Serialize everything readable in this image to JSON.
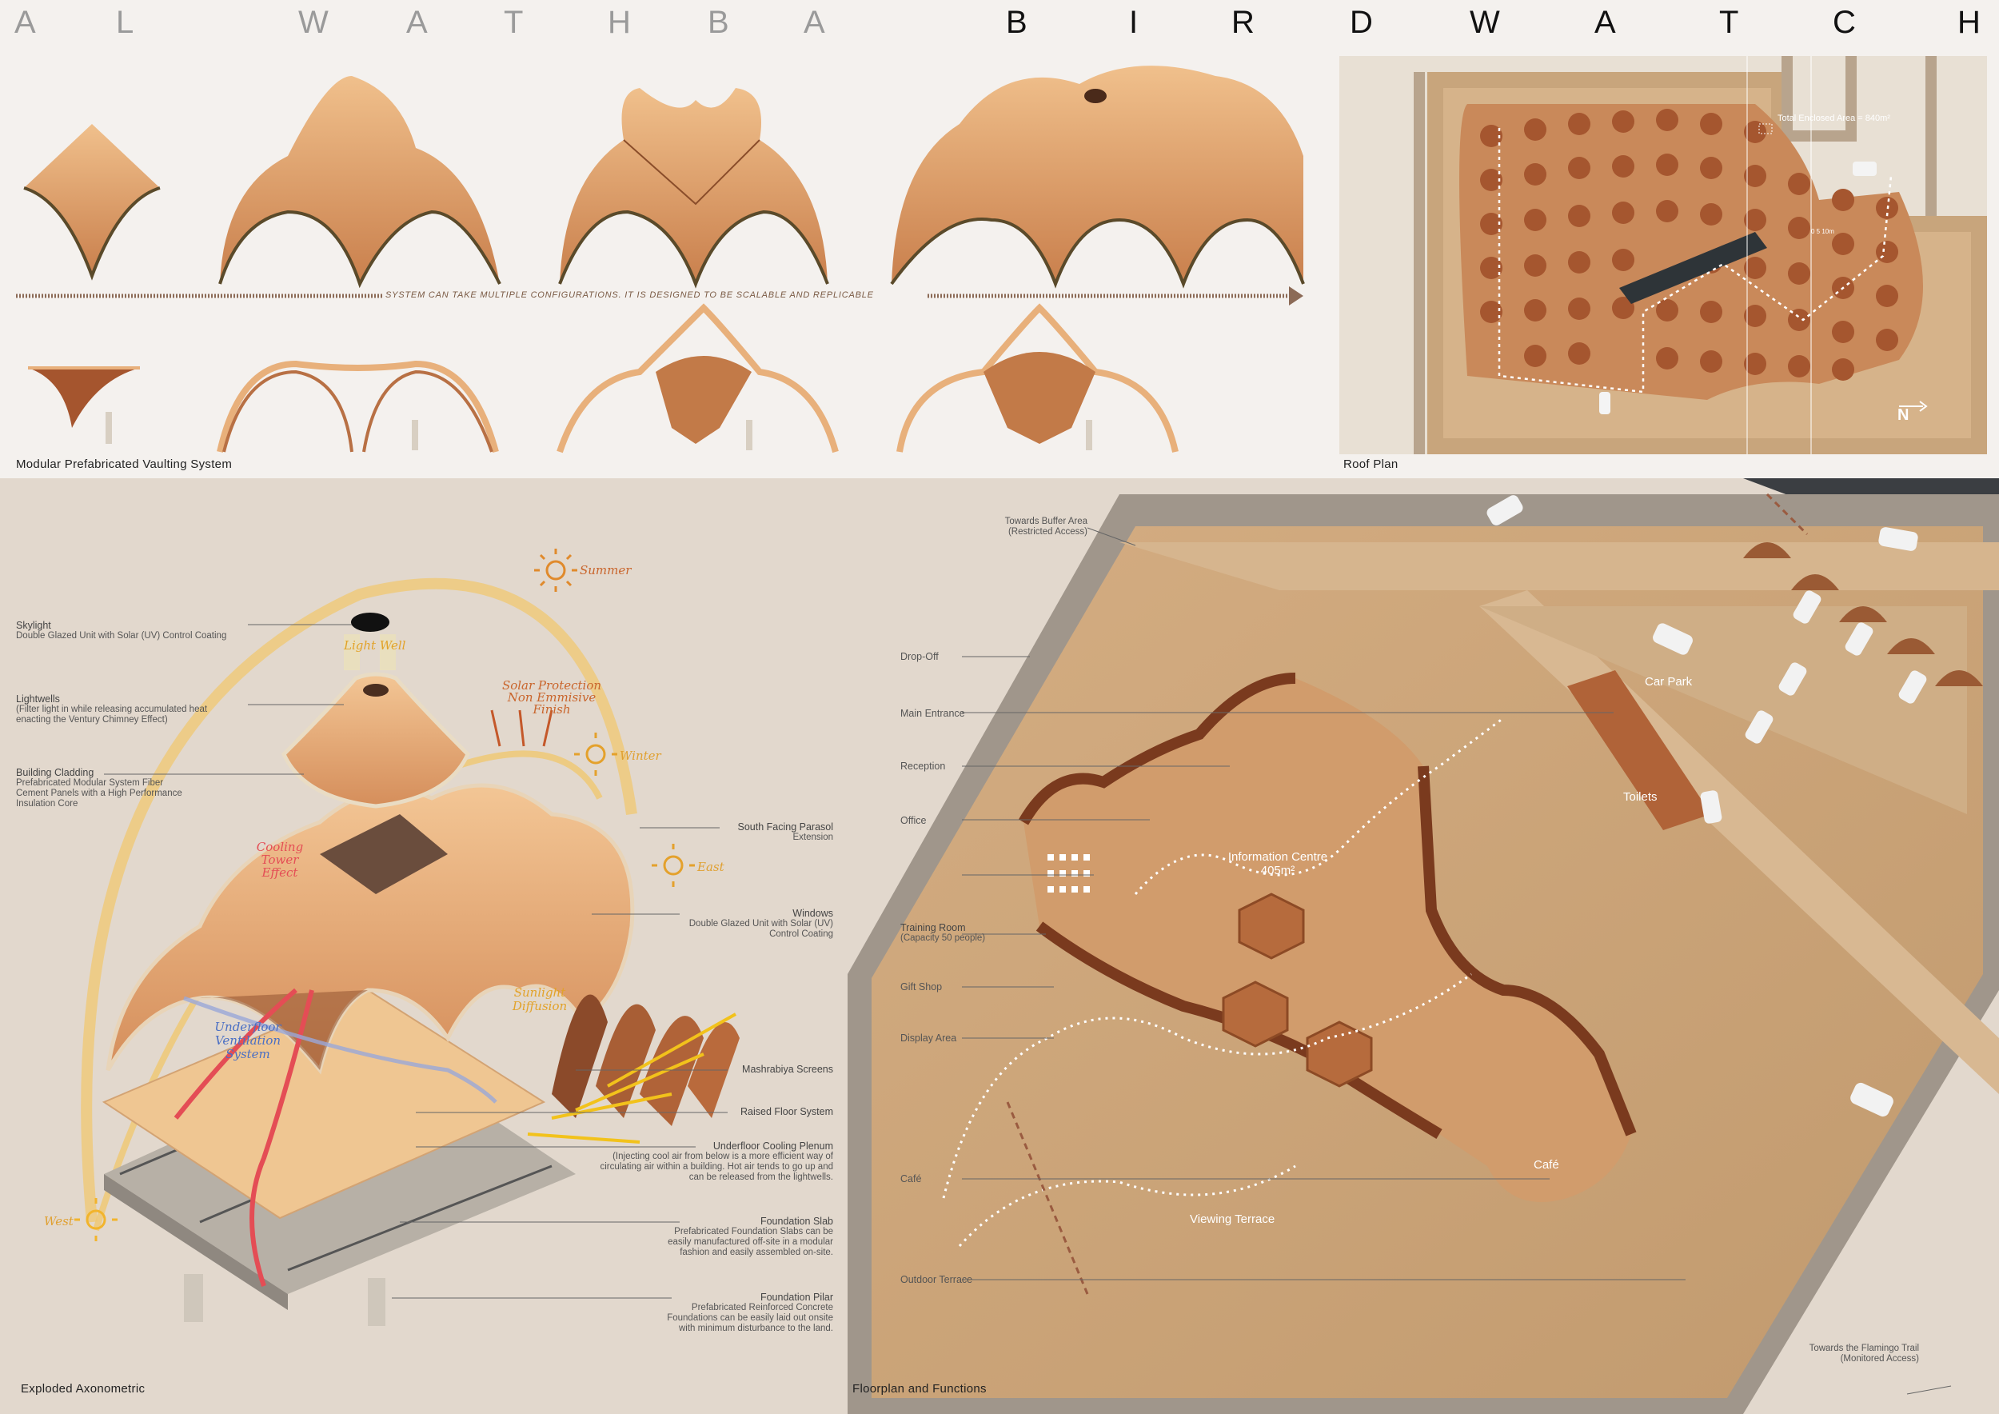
{
  "title": {
    "left_letters": [
      "A",
      "L",
      "W",
      "A",
      "T",
      "H",
      "B",
      "A"
    ],
    "right_letters": [
      "B",
      "I",
      "R",
      "D",
      "W",
      "A",
      "T",
      "C",
      "H"
    ]
  },
  "vaulting": {
    "caption": "Modular Prefabricated Vaulting System",
    "arrow_text": "SYSTEM CAN TAKE MULTIPLE CONFIGURATIONS. IT IS DESIGNED TO BE SCALABLE AND REPLICABLE"
  },
  "roof_plan": {
    "caption": "Roof Plan",
    "area_label": "Total Enclosed Area = 840m²",
    "scale_label": "0 5 10m",
    "north": "N"
  },
  "exploded": {
    "caption": "Exploded Axonometric",
    "labels": [
      {
        "title": "Skylight",
        "desc": "Double Glazed Unit with Solar (UV) Control Coating"
      },
      {
        "title": "Lightwells",
        "desc": "(Filter light in while releasing accumulated heat enacting the Ventury Chimney Effect)"
      },
      {
        "title": "Building Cladding",
        "desc": "Prefabricated Modular System Fiber Cement Panels with a High Performance Insulation Core"
      },
      {
        "title": "South Facing Parasol",
        "desc": "Extension"
      },
      {
        "title": "Windows",
        "desc": "Double Glazed Unit with Solar (UV) Control Coating"
      },
      {
        "title": "Mashrabiya Screens",
        "desc": ""
      },
      {
        "title": "Raised Floor System",
        "desc": ""
      },
      {
        "title": "Underfloor Cooling Plenum",
        "desc": "(Injecting cool air from below is a more efficient way of circulating air within a building. Hot air tends to go up and can be released from the lightwells."
      },
      {
        "title": "Foundation Slab",
        "desc": "Prefabricated Foundation Slabs can be easily manufactured off-site in a modular fashion and easily assembled on-site."
      },
      {
        "title": "Foundation Pilar",
        "desc": "Prefabricated Reinforced Concrete Foundations can be easily laid out onsite with minimum disturbance to the land."
      }
    ],
    "hand": {
      "summer": "Summer",
      "winter": "Winter",
      "east": "East",
      "west": "West",
      "light_well": "Light Well",
      "solar": "Solar Protection",
      "solar2": "Non Emmisive Finish",
      "cooling": "Cooling Tower",
      "cooling2": "Effect",
      "sunlight": "Sunlight",
      "sunlight2": "Diffusion",
      "underfloor": "Underfloor Ventilation",
      "underfloor2": "System"
    }
  },
  "floorplan": {
    "caption": "Floorplan and Functions",
    "labels": [
      "Drop-Off",
      "Main Entrance",
      "Reception",
      "Office",
      "Training Room",
      "(Capacity 50 people)",
      "Gift Shop",
      "Display Area",
      "Café",
      "Outdoor Terrace"
    ],
    "buffer": "Towards Buffer Area",
    "buffer2": "(Restricted Access)",
    "flamingo": "Towards the Flamingo Trail",
    "flamingo2": "(Monitored Access)",
    "car_park": "Car Park",
    "toilets": "Toilets",
    "info": "Information Centre",
    "info_area": "405m²",
    "viewing": "Viewing Terrace",
    "cafe": "Café"
  },
  "colors": {
    "sand": "#d9a877",
    "shell": "#e8b483",
    "dark_shell": "#7a4326",
    "brick": "#b55f34",
    "panel_bg": "#e4dcd1",
    "ground": "#c89e72"
  }
}
